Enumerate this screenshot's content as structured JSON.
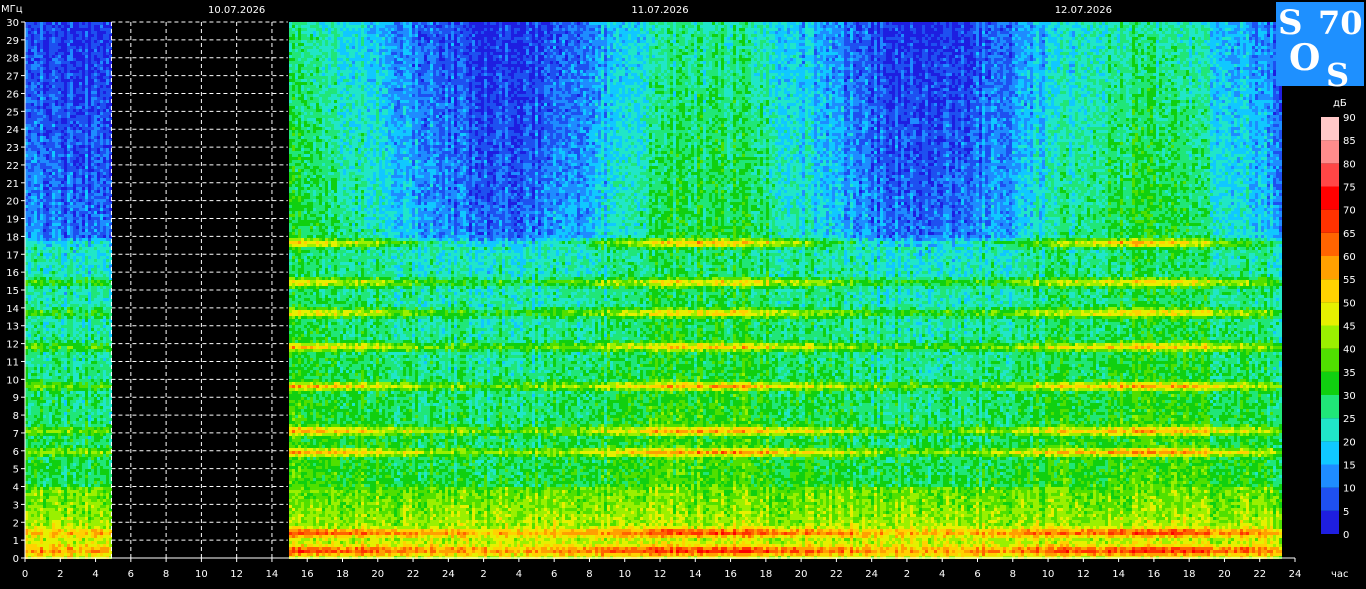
{
  "chart_data": {
    "type": "heatmap",
    "title": "",
    "ylabel": "МГц",
    "xlabel": "час",
    "colorbar_label": "дБ",
    "dates": [
      "10.07.2026",
      "11.07.2026",
      "12.07.2026"
    ],
    "ylim": [
      0,
      30
    ],
    "y_ticks": [
      0,
      1,
      2,
      3,
      4,
      5,
      6,
      7,
      8,
      9,
      10,
      11,
      12,
      13,
      14,
      15,
      16,
      17,
      18,
      19,
      20,
      21,
      22,
      23,
      24,
      25,
      26,
      27,
      28,
      29,
      30
    ],
    "x_range_hours": [
      0,
      72
    ],
    "x_tick_labels": [
      "0",
      "2",
      "4",
      "6",
      "8",
      "10",
      "12",
      "14",
      "16",
      "18",
      "20",
      "22",
      "24",
      "2",
      "4",
      "6",
      "8",
      "10",
      "12",
      "14",
      "16",
      "18",
      "20",
      "22",
      "24",
      "2",
      "4",
      "6",
      "8",
      "10",
      "12",
      "14",
      "16",
      "18",
      "20",
      "22",
      "24"
    ],
    "data_end_hour": 71.1,
    "gap_hours": [
      4.9,
      14.9
    ],
    "colorbar_ticks": [
      0,
      5,
      10,
      15,
      20,
      25,
      30,
      35,
      40,
      45,
      50,
      55,
      60,
      65,
      70,
      75,
      80,
      85,
      90
    ],
    "colorscale": [
      {
        "db": 0,
        "color": "#1e1ee0"
      },
      {
        "db": 5,
        "color": "#1e50f0"
      },
      {
        "db": 10,
        "color": "#1e8cff"
      },
      {
        "db": 15,
        "color": "#10c8ff"
      },
      {
        "db": 20,
        "color": "#20e6c8"
      },
      {
        "db": 25,
        "color": "#20e678"
      },
      {
        "db": 30,
        "color": "#10d010"
      },
      {
        "db": 35,
        "color": "#50e000"
      },
      {
        "db": 40,
        "color": "#9af000"
      },
      {
        "db": 45,
        "color": "#e6f000"
      },
      {
        "db": 50,
        "color": "#ffd200"
      },
      {
        "db": 55,
        "color": "#ffa000"
      },
      {
        "db": 60,
        "color": "#ff6400"
      },
      {
        "db": 65,
        "color": "#ff3200"
      },
      {
        "db": 70,
        "color": "#ff0000"
      },
      {
        "db": 75,
        "color": "#ff4646"
      },
      {
        "db": 80,
        "color": "#ff8c8c"
      },
      {
        "db": 85,
        "color": "#ffc8c8"
      },
      {
        "db": 90,
        "color": "#ffffff"
      }
    ],
    "grid": true,
    "description_bands_mhz": [
      0.5,
      1.5,
      6.0,
      7.2,
      9.7,
      11.9,
      13.8,
      15.5,
      17.7
    ]
  },
  "logo": {
    "text_s1": "S",
    "text_70": "70",
    "text_o": "O",
    "text_s2": "S",
    "bg": "#1e90ff"
  }
}
